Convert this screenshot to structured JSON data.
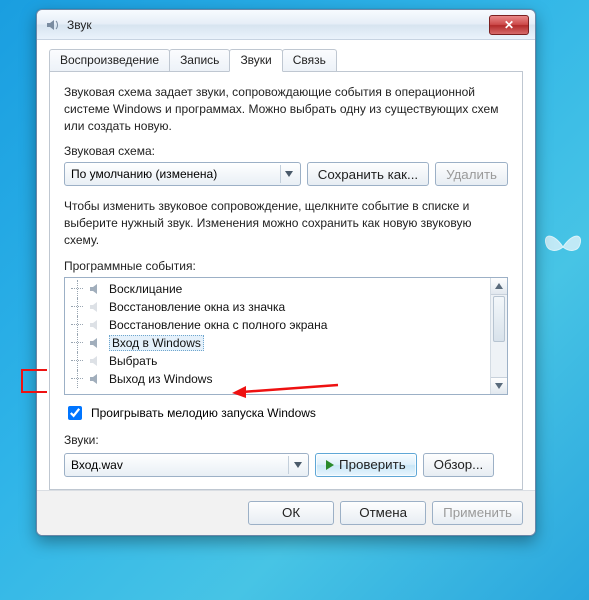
{
  "title": "Звук",
  "tabs": [
    {
      "label": "Воспроизведение"
    },
    {
      "label": "Запись"
    },
    {
      "label": "Звуки",
      "active": true
    },
    {
      "label": "Связь"
    }
  ],
  "scheme": {
    "description": "Звуковая схема задает звуки, сопровождающие события в операционной системе Windows и программах. Можно выбрать одну из существующих схем или создать новую.",
    "label": "Звуковая схема:",
    "selected": "По умолчанию (изменена)",
    "save_as": "Сохранить как...",
    "delete": "Удалить"
  },
  "events": {
    "description": "Чтобы изменить звуковое сопровождение, щелкните событие в списке и выберите нужный звук. Изменения можно сохранить как новую звуковую схему.",
    "label": "Программные события:",
    "items": [
      {
        "icon": "speaker",
        "label": "Восклицание"
      },
      {
        "icon": "none",
        "label": "Восстановление окна из значка"
      },
      {
        "icon": "none",
        "label": "Восстановление окна с полного экрана"
      },
      {
        "icon": "speaker",
        "label": "Вход в Windows",
        "selected": true
      },
      {
        "icon": "none",
        "label": "Выбрать"
      },
      {
        "icon": "speaker",
        "label": "Выход из Windows"
      }
    ]
  },
  "play_startup": {
    "label": "Проигрывать мелодию запуска Windows",
    "checked": true
  },
  "sounds": {
    "label": "Звуки:",
    "selected": "Вход.wav",
    "test": "Проверить",
    "browse": "Обзор..."
  },
  "buttons": {
    "ok": "ОК",
    "cancel": "Отмена",
    "apply": "Применить"
  }
}
